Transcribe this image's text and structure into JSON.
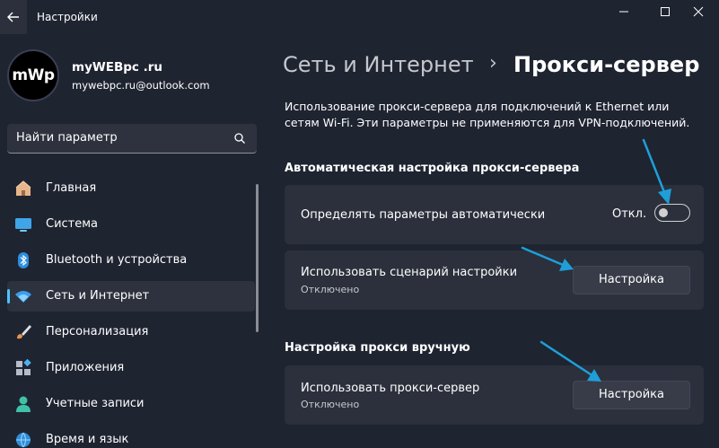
{
  "window": {
    "app_title": "Настройки"
  },
  "user": {
    "avatar_text": "mWp",
    "name": "myWEBpc .ru",
    "email": "mywebpc.ru@outlook.com"
  },
  "search": {
    "placeholder": "Найти параметр"
  },
  "sidebar": {
    "items": [
      {
        "label": "Главная",
        "icon": "home-icon",
        "active": false
      },
      {
        "label": "Система",
        "icon": "system-icon",
        "active": false
      },
      {
        "label": "Bluetooth и устройства",
        "icon": "bluetooth-icon",
        "active": false
      },
      {
        "label": "Сеть и Интернет",
        "icon": "wifi-icon",
        "active": true
      },
      {
        "label": "Персонализация",
        "icon": "brush-icon",
        "active": false
      },
      {
        "label": "Приложения",
        "icon": "apps-icon",
        "active": false
      },
      {
        "label": "Учетные записи",
        "icon": "account-icon",
        "active": false
      },
      {
        "label": "Время и язык",
        "icon": "globe-icon",
        "active": false
      }
    ]
  },
  "breadcrumb": {
    "parent": "Сеть и Интернет",
    "separator": "›",
    "current": "Прокси-сервер"
  },
  "description": "Использование прокси-сервера для подключений к Ethernet или сетям Wi-Fi. Эти параметры не применяются для VPN-подключений.",
  "auto_section": {
    "header": "Автоматическая настройка прокси-сервера",
    "detect": {
      "title": "Определять параметры автоматически",
      "toggle_label": "Откл.",
      "toggle_on": false
    },
    "script": {
      "title": "Использовать сценарий настройки",
      "subtitle": "Отключено",
      "button": "Настройка"
    }
  },
  "manual_section": {
    "header": "Настройка прокси вручную",
    "proxy": {
      "title": "Использовать прокси-сервер",
      "subtitle": "Отключено",
      "button": "Настройка"
    }
  },
  "colors": {
    "background": "#1f2431",
    "card": "#2b303c",
    "accent": "#4cc2ff",
    "annotation_arrow": "#1e9fd8"
  }
}
